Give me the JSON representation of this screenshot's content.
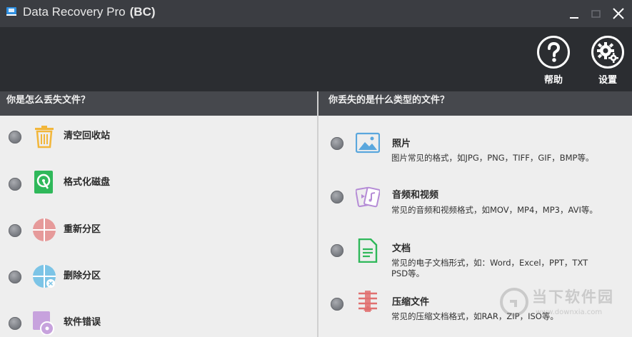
{
  "titlebar": {
    "title": "Data Recovery Pro",
    "edition": "(BC)"
  },
  "toolbar": {
    "help_label": "帮助",
    "settings_label": "设置"
  },
  "left": {
    "header": "你是怎么丢失文件？",
    "options": [
      {
        "label": "清空回收站",
        "icon": "recycle-bin-icon",
        "color": "#f2b63a"
      },
      {
        "label": "格式化磁盘",
        "icon": "disk-format-icon",
        "color": "#2fb85a"
      },
      {
        "label": "重新分区",
        "icon": "repartition-icon",
        "color": "#e69a9a"
      },
      {
        "label": "删除分区",
        "icon": "delete-partition-icon",
        "color": "#7cc4e6"
      },
      {
        "label": "软件错误",
        "icon": "software-error-icon",
        "color": "#c7a2dd"
      }
    ]
  },
  "right": {
    "header": "你丢失的是什么类型的文件？",
    "options": [
      {
        "label": "照片",
        "desc": "图片常见的格式，如JPG，PNG，TIFF，GIF，BMP等。",
        "icon": "photo-icon",
        "color": "#5aa7dd"
      },
      {
        "label": "音频和视频",
        "desc": "常见的音频和视频格式，如MOV，MP4，MP3，AVI等。",
        "icon": "audio-video-icon",
        "color": "#b58cd6"
      },
      {
        "label": "文档",
        "desc": "常见的电子文档形式，如：Word，Excel，PPT，TXT PSD等。",
        "icon": "document-icon",
        "color": "#2fb85a"
      },
      {
        "label": "压缩文件",
        "desc": "常见的压缩文档格式，如RAR，ZIP，ISO等。",
        "icon": "archive-icon",
        "color": "#e07070"
      }
    ]
  },
  "watermark": {
    "text": "当下软件园",
    "url": "www.downxia.com"
  }
}
